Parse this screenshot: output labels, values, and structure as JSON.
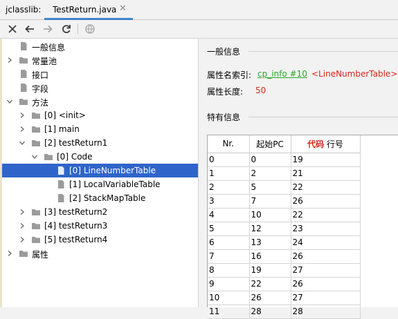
{
  "tabs": {
    "static_label": "jclasslib:",
    "active_label": "TestReturn.java",
    "close_glyph": "✕"
  },
  "toolbar": {
    "buttons": [
      "close-icon",
      "back-arrow-icon",
      "forward-arrow-icon",
      "refresh-icon",
      "web-icon"
    ]
  },
  "tree": {
    "items": [
      {
        "label": "一般信息",
        "type": "file",
        "expandable": false
      },
      {
        "label": "常量池",
        "type": "folder",
        "expandable": true,
        "expanded": false
      },
      {
        "label": "接口",
        "type": "file",
        "expandable": false
      },
      {
        "label": "字段",
        "type": "file",
        "expandable": false
      },
      {
        "label": "方法",
        "type": "folder",
        "expandable": true,
        "expanded": true
      },
      {
        "label": "[0] <init>",
        "type": "folder",
        "expandable": true,
        "expanded": false
      },
      {
        "label": "[1] main",
        "type": "folder",
        "expandable": true,
        "expanded": false
      },
      {
        "label": "[2] testReturn1",
        "type": "folder",
        "expandable": true,
        "expanded": true
      },
      {
        "label": "[0] Code",
        "type": "folder",
        "expandable": true,
        "expanded": true
      },
      {
        "label": "[0] LineNumberTable",
        "type": "file",
        "expandable": false,
        "selected": true
      },
      {
        "label": "[1] LocalVariableTable",
        "type": "file",
        "expandable": false
      },
      {
        "label": "[2] StackMapTable",
        "type": "file",
        "expandable": false
      },
      {
        "label": "[3] testReturn2",
        "type": "folder",
        "expandable": true,
        "expanded": false
      },
      {
        "label": "[4] testReturn3",
        "type": "folder",
        "expandable": true,
        "expanded": false
      },
      {
        "label": "[5] testReturn4",
        "type": "folder",
        "expandable": true,
        "expanded": false
      },
      {
        "label": "属性",
        "type": "folder",
        "expandable": true,
        "expanded": false
      }
    ]
  },
  "general": {
    "section_title": "一般信息",
    "name_index_label": "属性名索引:",
    "name_index_link": "cp_info #10",
    "name_index_value": "<LineNumberTable>",
    "length_label": "属性长度:",
    "length_value": "50"
  },
  "specific": {
    "section_title": "特有信息"
  },
  "table": {
    "headers": {
      "nr": "Nr.",
      "start_pc": "起始PC",
      "code_red": "代码",
      "line_no": "行号"
    },
    "rows": [
      [
        "0",
        "0",
        "19"
      ],
      [
        "1",
        "2",
        "21"
      ],
      [
        "2",
        "5",
        "22"
      ],
      [
        "3",
        "7",
        "26"
      ],
      [
        "4",
        "10",
        "22"
      ],
      [
        "5",
        "12",
        "23"
      ],
      [
        "6",
        "13",
        "24"
      ],
      [
        "7",
        "16",
        "26"
      ],
      [
        "8",
        "19",
        "27"
      ],
      [
        "9",
        "22",
        "26"
      ],
      [
        "10",
        "26",
        "27"
      ],
      [
        "11",
        "28",
        "28"
      ]
    ]
  },
  "colors": {
    "selection": "#2f65ca",
    "tab_underline": "#4083c9",
    "link_green": "#2ba52b",
    "value_red": "#d9261c"
  }
}
